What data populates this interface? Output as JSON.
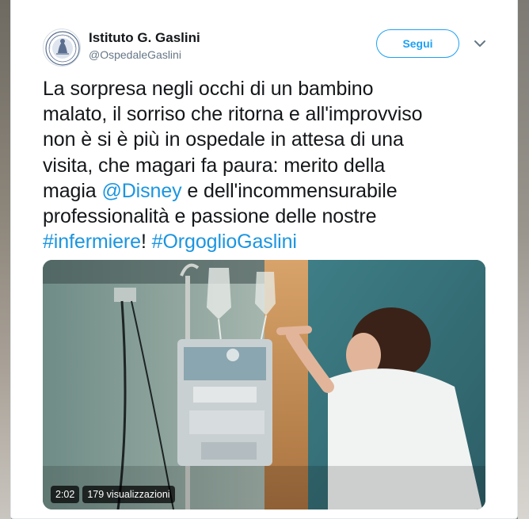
{
  "tweet": {
    "author_name": "Istituto G. Gaslini",
    "author_handle": "@OspedaleGaslini",
    "follow_label": "Segui",
    "text_segments": [
      {
        "text": "La sorpresa negli occhi di un bambino",
        "type": "plain"
      },
      {
        "text": "malato, il sorriso che ritorna e all'improvviso",
        "type": "plain"
      },
      {
        "text": "non è si è più in ospedale in attesa di una",
        "type": "plain"
      },
      {
        "text": "visita, che magari fa paura: merito della",
        "type": "plain"
      },
      {
        "text": "magia ",
        "type": "plain"
      },
      {
        "text": "@Disney",
        "type": "mention"
      },
      {
        "text": " e dell'incommensurabile",
        "type": "plain"
      },
      {
        "text": "professionalità e passione delle nostre",
        "type": "plain"
      },
      {
        "text": "#infermiere",
        "type": "hashtag"
      },
      {
        "text": "! ",
        "type": "plain"
      },
      {
        "text": "#OrgoglioGaslini",
        "type": "hashtag"
      }
    ],
    "video": {
      "duration": "2:02",
      "views": "179 visualizzazioni"
    }
  },
  "icons": {
    "avatar": "hospital-seal-logo",
    "menu": "chevron-down-icon"
  },
  "colors": {
    "link": "#1b95e0",
    "follow_accent": "#1da1f2",
    "text": "#14171a",
    "secondary": "#657786"
  }
}
